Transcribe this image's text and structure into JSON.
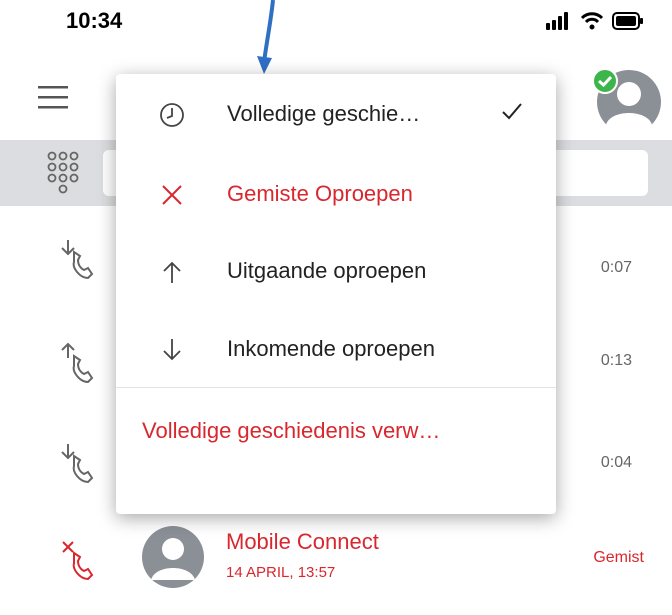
{
  "status_bar": {
    "time": "10:34",
    "icons": [
      "signal-icon",
      "wifi-icon",
      "battery-icon"
    ]
  },
  "app_bar": {
    "menu_icon": "hamburger-icon",
    "avatar_icon": "avatar-icon",
    "presence_icon": "available-check-icon"
  },
  "search_bar": {
    "dialpad_icon": "dialpad-icon",
    "placeholder": ""
  },
  "filter_menu": {
    "items": [
      {
        "icon": "clock-icon",
        "label": "Volledige geschie…",
        "selected": true
      },
      {
        "icon": "close-x-icon",
        "label": "Gemiste Oproepen",
        "selected": false
      },
      {
        "icon": "arrow-up-icon",
        "label": "Uitgaande oproepen",
        "selected": false
      },
      {
        "icon": "arrow-down-icon",
        "label": "Inkomende oproepen",
        "selected": false
      }
    ],
    "clear_label": "Volledige geschiedenis verw…"
  },
  "call_list": [
    {
      "type": "incoming",
      "icon": "incoming-call-icon",
      "duration": "0:07"
    },
    {
      "type": "outgoing",
      "icon": "outgoing-call-icon",
      "duration": "0:13"
    },
    {
      "type": "incoming",
      "icon": "incoming-call-icon",
      "duration": "0:04"
    },
    {
      "type": "missed",
      "icon": "missed-call-icon",
      "name": "Mobile Connect",
      "date": "14 APRIL, 13:57",
      "status": "Gemist"
    }
  ],
  "colors": {
    "accent_red": "#d9272e",
    "annotation_blue": "#2f6fc4",
    "presence_green": "#3cb54a",
    "search_bar_gray": "#dcdde0"
  }
}
